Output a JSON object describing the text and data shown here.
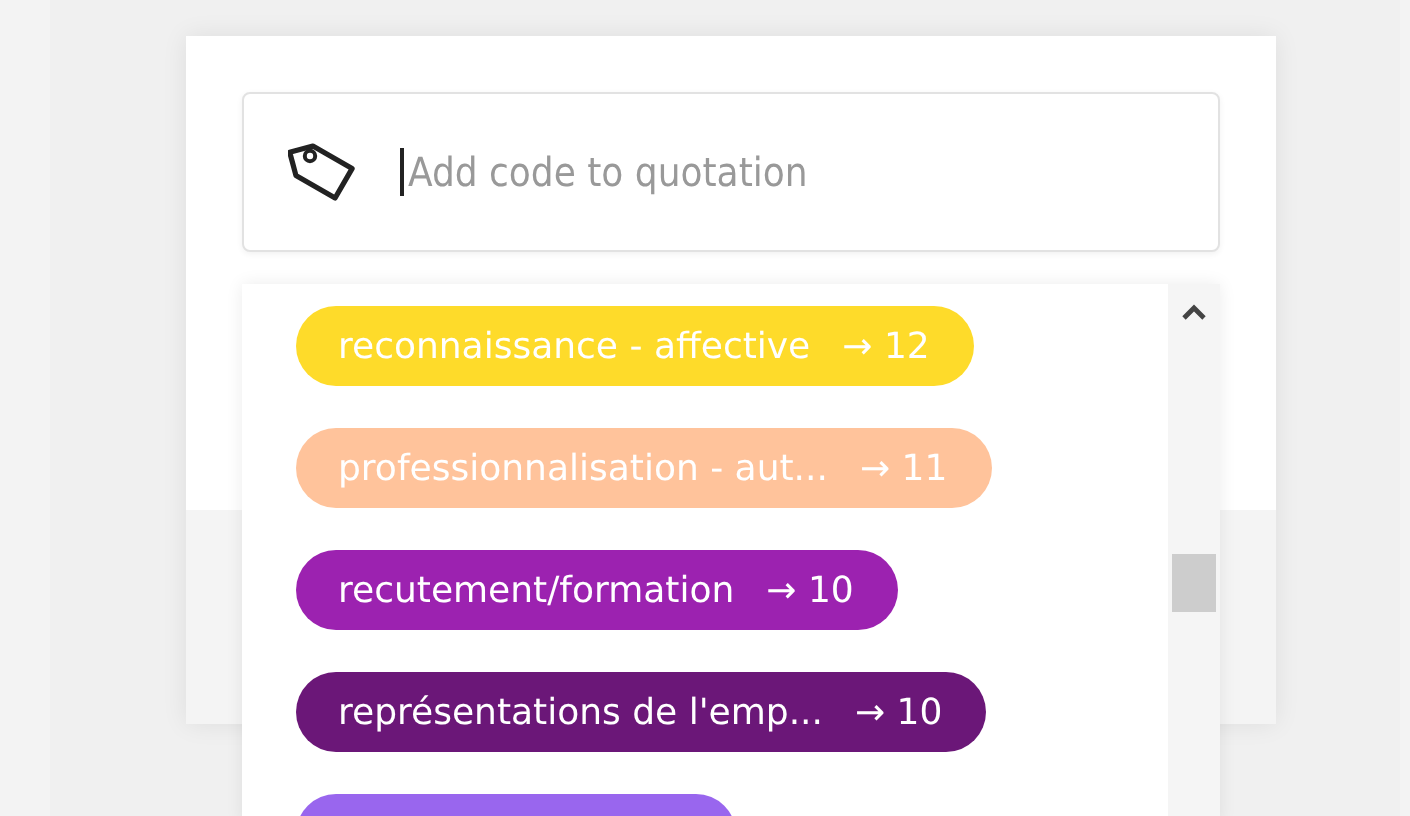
{
  "search": {
    "placeholder": "Add code to quotation"
  },
  "codes": [
    {
      "label": "reconnaissance - affective",
      "count": "→ 12",
      "color": "#fedb2a"
    },
    {
      "label": "professionnalisation - aut...",
      "count": "→ 11",
      "color": "#ffc39b"
    },
    {
      "label": "recutement/formation",
      "count": "→ 10",
      "color": "#9c22b0"
    },
    {
      "label": "représentations de l'emp...",
      "count": "→ 10",
      "color": "#6b1778"
    }
  ],
  "partial_code": {
    "color": "#9966ee"
  }
}
